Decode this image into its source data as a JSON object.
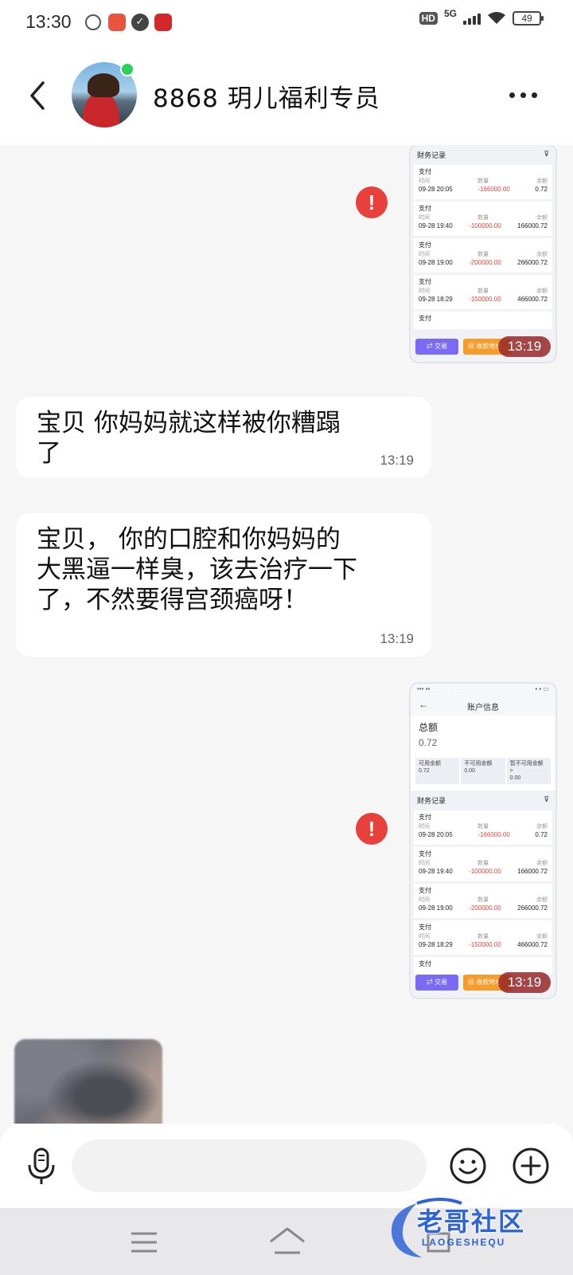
{
  "status_bar": {
    "time": "13:30",
    "hd": "HD",
    "network": "5G",
    "battery": "49"
  },
  "header": {
    "contact_name": "8868  玥儿福利专员",
    "online_color": "#2dd05c"
  },
  "messages": [
    {
      "type": "image",
      "sender": "self",
      "failed": true,
      "time": "13:19",
      "screenshot": {
        "section_title": "财务记录",
        "rows": [
          {
            "type": "支付",
            "labels": [
              "时间",
              "数量",
              "余额"
            ],
            "date": "09-28 20:05",
            "amount": "-166000.00",
            "balance": "0.72"
          },
          {
            "type": "支付",
            "labels": [
              "时间",
              "数量",
              "余额"
            ],
            "date": "09-28 19:40",
            "amount": "-100000.00",
            "balance": "166000.72"
          },
          {
            "type": "支付",
            "labels": [
              "时间",
              "数量",
              "余额"
            ],
            "date": "09-28 19:00",
            "amount": "-200000.00",
            "balance": "266000.72"
          },
          {
            "type": "支付",
            "labels": [
              "时间",
              "数量",
              "余额"
            ],
            "date": "09-28 18:29",
            "amount": "-150000.00",
            "balance": "466000.72"
          },
          {
            "type": "支付",
            "labels": [
              "时间",
              "数量",
              "余额"
            ],
            "date": "",
            "amount": "",
            "balance": ""
          }
        ],
        "trade_button": "交易",
        "receive_button": "收款地址"
      }
    },
    {
      "type": "text",
      "sender": "other",
      "text": "宝贝  你妈妈就这样被你糟蹋了",
      "time": "13:19"
    },
    {
      "type": "text",
      "sender": "other",
      "text": "宝贝， 你的口腔和你妈妈的大黑逼一样臭，该去治疗一下了，不然要得宫颈癌呀！",
      "time": "13:19"
    },
    {
      "type": "image",
      "sender": "self",
      "failed": true,
      "time": "13:19",
      "screenshot": {
        "overlay_time": "00:07",
        "app_title": "账户信息",
        "total_label": "总额",
        "total_value": "0.72",
        "stats": [
          {
            "label": "可用余额",
            "value": "0.72"
          },
          {
            "label": "不可用余额",
            "value": "0.00"
          },
          {
            "label": "暂不可用余额 >",
            "value": "0.00"
          }
        ],
        "section_title": "财务记录",
        "rows": [
          {
            "type": "支付",
            "labels": [
              "时间",
              "数量",
              "余额"
            ],
            "date": "09-28 20:05",
            "amount": "-166000.00",
            "balance": "0.72"
          },
          {
            "type": "支付",
            "labels": [
              "时间",
              "数量",
              "余额"
            ],
            "date": "09-28 19:40",
            "amount": "-100000.00",
            "balance": "166000.72"
          },
          {
            "type": "支付",
            "labels": [
              "时间",
              "数量",
              "余额"
            ],
            "date": "09-28 19:00",
            "amount": "-200000.00",
            "balance": "266000.72"
          },
          {
            "type": "支付",
            "labels": [
              "时间",
              "数量",
              "余额"
            ],
            "date": "09-28 18:29",
            "amount": "-150000.00",
            "balance": "466000.72"
          },
          {
            "type": "支付",
            "labels": [
              "时间",
              "数量",
              "余额"
            ],
            "date": "",
            "amount": "",
            "balance": ""
          }
        ],
        "trade_button": "交易",
        "receive_button": "收款地址"
      }
    },
    {
      "type": "image",
      "sender": "other",
      "blurred": true
    }
  ],
  "input_bar": {
    "placeholder": ""
  },
  "watermark": {
    "text": "老哥社区",
    "sub": "LAOGESHEQU"
  },
  "icons": [
    "back-arrow-icon",
    "more-dots-icon",
    "error-icon",
    "microphone-icon",
    "emoji-icon",
    "plus-icon",
    "menu-icon",
    "home-icon",
    "back-nav-icon"
  ]
}
